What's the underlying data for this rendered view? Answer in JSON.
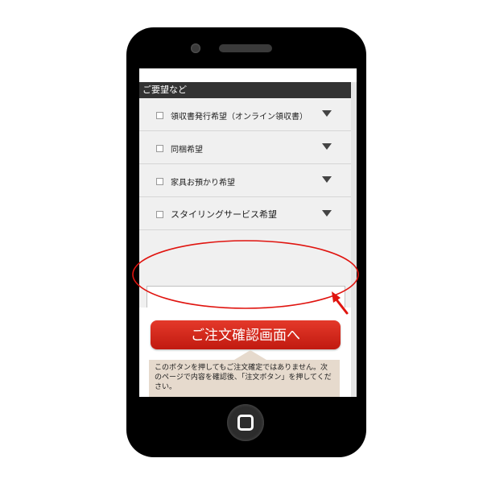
{
  "section": {
    "title": "ご要望など"
  },
  "options": [
    {
      "label": "領収書発行希望（オンライン領収書）"
    },
    {
      "label": "同梱希望"
    },
    {
      "label": "家具お預かり希望"
    },
    {
      "label": "スタイリングサービス希望"
    }
  ],
  "comment": {
    "value": ""
  },
  "confirm_button": {
    "label": "ご注文確認画面へ"
  },
  "note": {
    "text": "このボタンを押してもご注文確定ではありません。次のページで内容を確認後、「注文ボタン」を押してください。"
  },
  "colors": {
    "annotation": "#e0140f",
    "button": "#d42a1e",
    "header_bg": "#333333",
    "note_bg": "#e6dacd"
  },
  "icons": {
    "option_expand": "triangle-down-icon",
    "home": "home-button-icon"
  }
}
